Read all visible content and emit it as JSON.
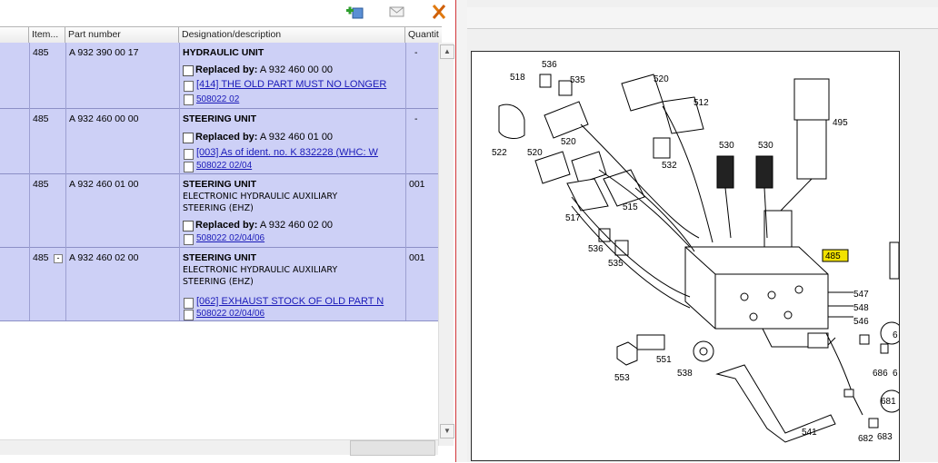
{
  "columns": [
    "Item...",
    "Part number",
    "Designation/description",
    "Quantit"
  ],
  "rows": [
    {
      "item": "485",
      "part_number": "A 932 390 00 17",
      "title": "HYDRAULIC UNIT",
      "sub": [],
      "qty": "-",
      "replaced_label": "Replaced by:",
      "replaced_value": "A 932 460 00 00",
      "links": [
        "[414] THE OLD PART MUST NO LONGER",
        "508022 02"
      ]
    },
    {
      "item": "485",
      "part_number": "A 932 460 00 00",
      "title": "STEERING UNIT",
      "sub": [],
      "qty": "-",
      "replaced_label": "Replaced by:",
      "replaced_value": "A 932 460 01 00",
      "links": [
        "[003] As of ident. no. K 832228 (WHC: W",
        "508022 02/04"
      ]
    },
    {
      "item": "485",
      "part_number": "A 932 460 01 00",
      "title": "STEERING UNIT",
      "sub": [
        "ELECTRONIC HYDRAULIC AUXILIARY",
        "STEERING (EHZ)"
      ],
      "qty": "001",
      "replaced_label": "Replaced by:",
      "replaced_value": "A 932 460 02 00",
      "links": [
        "508022 02/04/06"
      ]
    },
    {
      "item": "485",
      "part_number": "A 932 460 02 00",
      "title": "STEERING UNIT",
      "sub": [
        "ELECTRONIC HYDRAULIC AUXILIARY",
        "STEERING (EHZ)"
      ],
      "qty": "001",
      "links": [
        "[062] EXHAUST STOCK OF OLD PART N",
        "508022 02/04/06"
      ],
      "expander": "-"
    }
  ],
  "diagram": {
    "callouts": [
      "536",
      "518",
      "535",
      "520",
      "512",
      "495",
      "522",
      "520",
      "520",
      "532",
      "530",
      "530",
      "517",
      "515",
      "536",
      "535",
      "485",
      "547",
      "548",
      "546",
      "553",
      "551",
      "538",
      "686",
      "6",
      "681",
      "541",
      "682",
      "683",
      "6"
    ],
    "highlighted": "485",
    "highlight_color": "#f2e200"
  },
  "colors": {
    "row_bg": "#cdd0f6",
    "link": "#1a1ab8",
    "divider_accent": "#d1363a"
  }
}
